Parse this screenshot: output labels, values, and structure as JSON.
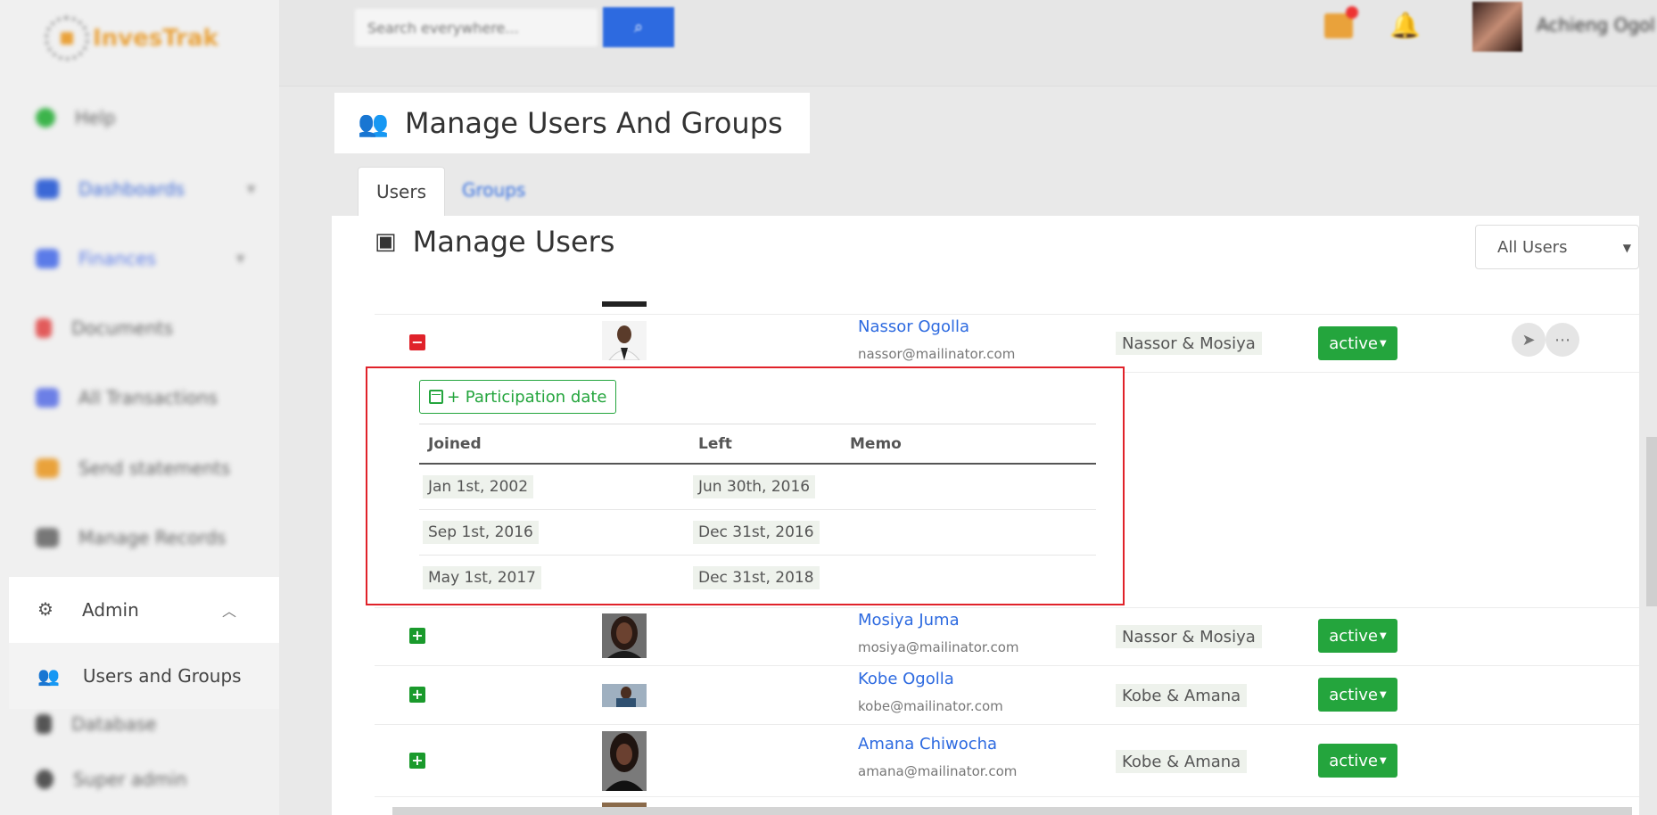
{
  "brand": {
    "name": "InvesTrak"
  },
  "sidebar": {
    "items": [
      {
        "label": "Help",
        "color": "#3cb44b"
      },
      {
        "label": "Dashboards",
        "color": "#3b68d6"
      },
      {
        "label": "Finances",
        "color": "#5b7be8"
      },
      {
        "label": "Documents",
        "color": "#e25b5b"
      },
      {
        "label": "All Transactions",
        "color": "#6c7fe6"
      },
      {
        "label": "Send statements",
        "color": "#e9a23b"
      },
      {
        "label": "Manage Records",
        "color": "#777777"
      }
    ],
    "admin": {
      "label": "Admin"
    },
    "users_groups": {
      "label": "Users and Groups"
    },
    "lower": [
      {
        "label": "Database"
      },
      {
        "label": "Super admin"
      }
    ]
  },
  "topbar": {
    "search_placeholder": "Search everywhere...",
    "user_name": "Achieng Ogol"
  },
  "page": {
    "title": "Manage Users And Groups",
    "tabs": [
      "Users",
      "Groups"
    ],
    "section_title": "Manage Users",
    "filter_value": "All Users"
  },
  "participation": {
    "button_label": "+ Participation date",
    "headers": [
      "Joined",
      "Left",
      "Memo"
    ],
    "rows": [
      {
        "joined": "Jan 1st, 2002",
        "left": "Jun 30th, 2016",
        "memo": ""
      },
      {
        "joined": "Sep 1st, 2016",
        "left": "Dec 31st, 2016",
        "memo": ""
      },
      {
        "joined": "May 1st, 2017",
        "left": "Dec 31st, 2018",
        "memo": ""
      }
    ]
  },
  "users": [
    {
      "name": "Nassor Ogolla",
      "email": "nassor@mailinator.com",
      "group": "Nassor & Mosiya",
      "status": "active"
    },
    {
      "name": "Mosiya Juma",
      "email": "mosiya@mailinator.com",
      "group": "Nassor & Mosiya",
      "status": "active"
    },
    {
      "name": "Kobe Ogolla",
      "email": "kobe@mailinator.com",
      "group": "Kobe & Amana",
      "status": "active"
    },
    {
      "name": "Amana Chiwocha",
      "email": "amana@mailinator.com",
      "group": "Kobe & Amana",
      "status": "active"
    }
  ],
  "colors": {
    "accent": "#2d6ae0",
    "success": "#24a53d",
    "danger": "#e0222a"
  }
}
